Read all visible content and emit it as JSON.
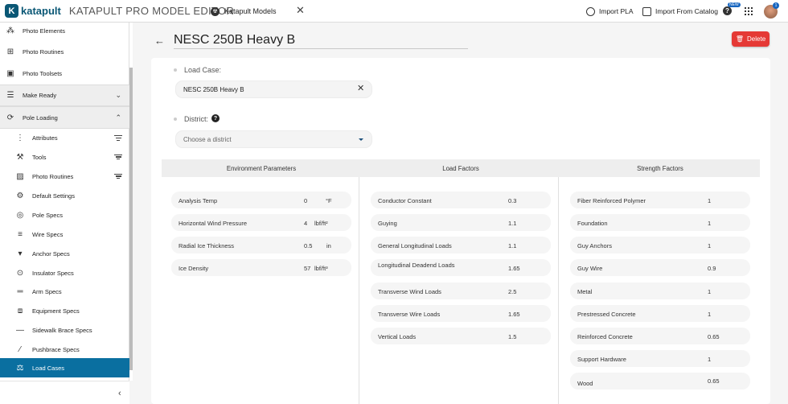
{
  "app": {
    "logo_text": "katapult",
    "title": "KATAPULT PRO MODEL EDITOR"
  },
  "tab": {
    "label": "Katapult Models",
    "close": "✕"
  },
  "toolbar": {
    "import_pla": "Import PLA",
    "import_catalog": "Import From Catalog",
    "help": "?",
    "new_badge": "NEW",
    "avatar_badge": "1"
  },
  "sidebar": {
    "items": [
      {
        "label": "Photo Elements"
      },
      {
        "label": "Photo Routines"
      },
      {
        "label": "Photo Toolsets"
      },
      {
        "label": "Make Ready"
      },
      {
        "label": "Pole Loading"
      },
      {
        "label": "Attributes"
      },
      {
        "label": "Tools"
      },
      {
        "label": "Photo Routines"
      },
      {
        "label": "Default Settings"
      },
      {
        "label": "Pole Specs"
      },
      {
        "label": "Wire Specs"
      },
      {
        "label": "Anchor Specs"
      },
      {
        "label": "Insulator Specs"
      },
      {
        "label": "Arm Specs"
      },
      {
        "label": "Equipment Specs"
      },
      {
        "label": "Sidewalk Brace Specs"
      },
      {
        "label": "Pushbrace Specs"
      },
      {
        "label": "Load Cases"
      }
    ],
    "collapse": "‹"
  },
  "page": {
    "title": "NESC 250B Heavy B",
    "delete_label": "Delete"
  },
  "form": {
    "load_case_label": "Load Case:",
    "load_case_value": "NESC 250B Heavy B",
    "district_label": "District:",
    "district_placeholder": "Choose a district"
  },
  "table": {
    "headers": [
      "Environment Parameters",
      "Load Factors",
      "Strength Factors"
    ],
    "environment": [
      {
        "name": "Analysis Temp",
        "value": "0",
        "unit": "°F"
      },
      {
        "name": "Horizontal Wind Pressure",
        "value": "4",
        "unit": "lbf/ft²"
      },
      {
        "name": "Radial Ice Thickness",
        "value": "0.5",
        "unit": "in"
      },
      {
        "name": "Ice Density",
        "value": "57",
        "unit": "lbf/ft³"
      }
    ],
    "load_factors": [
      {
        "name": "Conductor Constant",
        "value": "0.3"
      },
      {
        "name": "Guying",
        "value": "1.1"
      },
      {
        "name": "General Longitudinal Loads",
        "value": "1.1"
      },
      {
        "name": "Longitudinal Deadend Loads",
        "value": "1.65"
      },
      {
        "name": "Transverse Wind Loads",
        "value": "2.5"
      },
      {
        "name": "Transverse Wire Loads",
        "value": "1.65"
      },
      {
        "name": "Vertical Loads",
        "value": "1.5"
      }
    ],
    "strength_factors": [
      {
        "name": "Fiber Reinforced Polymer",
        "value": "1"
      },
      {
        "name": "Foundation",
        "value": "1"
      },
      {
        "name": "Guy Anchors",
        "value": "1"
      },
      {
        "name": "Guy Wire",
        "value": "0.9"
      },
      {
        "name": "Metal",
        "value": "1"
      },
      {
        "name": "Prestressed Concrete",
        "value": "1"
      },
      {
        "name": "Reinforced Concrete",
        "value": "0.65"
      },
      {
        "name": "Support Hardware",
        "value": "1"
      },
      {
        "name": "Wood",
        "value": "0.65"
      }
    ]
  },
  "colors": {
    "accent": "#0a6fa0",
    "brand": "#0a5775",
    "danger": "#e53935"
  }
}
